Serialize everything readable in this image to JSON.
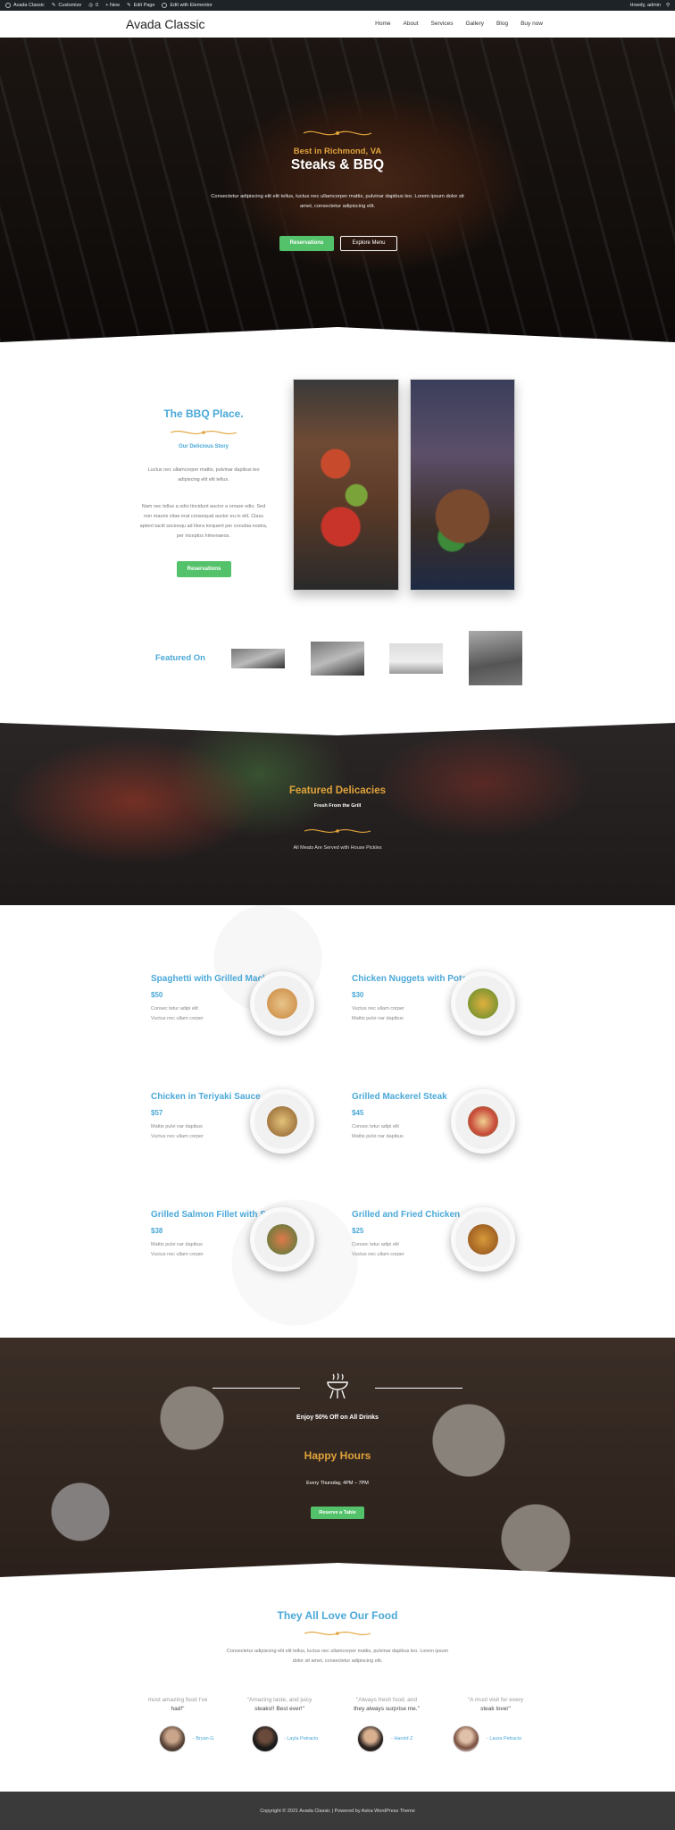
{
  "adminbar": {
    "items": [
      "Avada Classic",
      "Customize",
      "0",
      "+ New",
      "Edit Page",
      "Edit with Elementor"
    ],
    "howdy": "Howdy, admin"
  },
  "header": {
    "logo": "Avada Classic",
    "nav": [
      "Home",
      "About",
      "Services",
      "Gallery",
      "Blog",
      "Buy now"
    ]
  },
  "hero": {
    "kicker": "Best in Richmond, VA",
    "title": "Steaks & BBQ",
    "text": "Consectetur adipiscing elit elit tellus, luctus nec ullamcorper mattis, pulvinar dapibus leo. Lorem ipsum dolor sit amet, consectetur adipiscing elit.",
    "btn_reservations": "Reservations",
    "btn_menu": "Explore Menu"
  },
  "about": {
    "title": "The BBQ Place.",
    "subtitle": "Our Delicious Story",
    "para1": "Luctus nec ullamcorper mattis, pulvinar dapibus leo adipiscing elit elit tellus.",
    "para2": "Nam nec tellus a odio tincidunt auctor a ornare odio. Sed non mauris vitae erat consequat auctor eu in elit. Class aptent taciti sociosqu ad litora torquent per conubia nostra, per inceptos himenaeos.",
    "btn": "Reservations"
  },
  "featured_on": {
    "label": "Featured On"
  },
  "delicacies": {
    "title": "Featured Delicacies",
    "subtitle": "Fresh From the Grill",
    "text": "All Meats Are Served with House Pickles"
  },
  "menu": [
    {
      "name": "Spaghetti with Grilled Mackerel",
      "price": "$50",
      "desc": [
        "Consec tetur adipi elit",
        "Vuctus nec ullam corper"
      ]
    },
    {
      "name": "Chicken Nuggets with Potato",
      "price": "$30",
      "desc": [
        "Vuctus nec ullam corper",
        "Mattis pulvi nar dapibus"
      ]
    },
    {
      "name": "Chicken in Teriyaki Sauce",
      "price": "$57",
      "desc": [
        "Mattis pulvi nar dapibus",
        "Vuctus nec ullam corper"
      ]
    },
    {
      "name": "Grilled Mackerel Steak",
      "price": "$45",
      "desc": [
        "Consec tetur adipi elit",
        "Mattis pulvi nar dapibus"
      ]
    },
    {
      "name": "Grilled Salmon Fillet with Salad",
      "price": "$38",
      "desc": [
        "Mattis pulvi nar dapibus",
        "Vuctus nec ullam corper"
      ]
    },
    {
      "name": "Grilled and Fried Chicken",
      "price": "$25",
      "desc": [
        "Consec tetur adipi elit",
        "Vuctus nec ullam corper"
      ]
    }
  ],
  "happy": {
    "offer": "Enjoy 50% Off on All Drinks",
    "title": "Happy Hours",
    "time": "Every Thursday, 4PM – 7PM",
    "btn": "Reserve a Table"
  },
  "testimonials": {
    "title": "They All Love Our Food",
    "text": "Consectetur adipiscing elit elit tellus, luctus nec ullamcorper mattis, pulvinar dapibus leo. Lorem ipsum dolor sit amet, consectetur adipiscing elit.",
    "quotes": [
      {
        "line1": "most amazing food I've",
        "line2": "had!\"",
        "name": "- Bryan G"
      },
      {
        "line1": "\"Amazing taste, and juicy",
        "line2": "steaks!! Best ever!\"",
        "name": "- Layla Petracio"
      },
      {
        "line1": "\"Always fresh food, and",
        "line2": "they always surprise me.\"",
        "name": "- Harold Z"
      },
      {
        "line1": "\"A must visit for every",
        "line2": "steak lover\"",
        "name": "- Laura Petracio"
      }
    ]
  },
  "footer": {
    "text": "Copyright © 2021 Avada Classic | Powered by Astra WordPress Theme"
  }
}
